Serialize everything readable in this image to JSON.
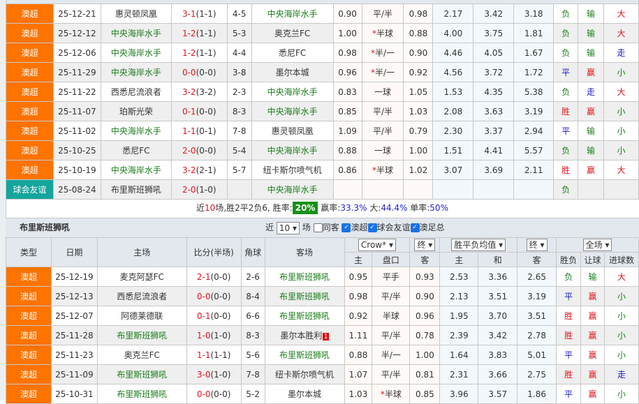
{
  "colors": {
    "league": "#ff7300",
    "friendly": "#14a59c",
    "win": "#e0141e",
    "lose": "#1b7d1b",
    "draw": "#1616c8"
  },
  "top_rows": [
    [
      "澳超",
      "25-12-21",
      "惠灵顿凤凰",
      "3-1",
      "(1-1)",
      "4-5",
      "中央海岸水手",
      "away",
      "0.90",
      "平/半",
      "0.98",
      "2.17",
      "3.42",
      "3.18",
      "负",
      "输",
      "大"
    ],
    [
      "澳超",
      "25-12-12",
      "中央海岸水手",
      "1-2",
      "(1-1)",
      "5-3",
      "奥克兰FC",
      "home",
      "1.00",
      "*半球",
      "0.88",
      "4.00",
      "3.75",
      "1.81",
      "负",
      "输",
      "大"
    ],
    [
      "澳超",
      "25-12-06",
      "中央海岸水手",
      "1-2",
      "(1-1)",
      "4-4",
      "悉尼FC",
      "home",
      "0.98",
      "*半/一",
      "0.90",
      "4.46",
      "4.05",
      "1.67",
      "负",
      "输",
      "走"
    ],
    [
      "澳超",
      "25-11-29",
      "中央海岸水手",
      "0-0",
      "(0-0)",
      "3-8",
      "墨尔本城",
      "home",
      "0.96",
      "*半/一",
      "0.92",
      "4.56",
      "3.72",
      "1.72",
      "平",
      "赢",
      "小"
    ],
    [
      "澳超",
      "25-11-22",
      "西悉尼流浪者",
      "3-2",
      "(3-2)",
      "2-3",
      "中央海岸水手",
      "away",
      "0.83",
      "一球",
      "1.05",
      "1.53",
      "4.35",
      "5.38",
      "负",
      "走",
      "大"
    ],
    [
      "澳超",
      "25-11-07",
      "珀斯光荣",
      "0-1",
      "(0-0)",
      "8-3",
      "中央海岸水手",
      "away",
      "0.85",
      "平/半",
      "1.03",
      "2.08",
      "3.63",
      "3.19",
      "胜",
      "赢",
      "小"
    ],
    [
      "澳超",
      "25-11-02",
      "中央海岸水手",
      "1-1",
      "(0-1)",
      "7-8",
      "惠灵顿凤凰",
      "home",
      "1.09",
      "平/半",
      "0.79",
      "2.30",
      "3.37",
      "2.94",
      "平",
      "输",
      "小"
    ],
    [
      "澳超",
      "25-10-25",
      "悉尼FC",
      "2-0",
      "(0-0)",
      "5-4",
      "中央海岸水手",
      "away",
      "0.88",
      "一球",
      "1.00",
      "1.51",
      "4.41",
      "5.57",
      "负",
      "输",
      "小"
    ],
    [
      "澳超",
      "25-10-19",
      "中央海岸水手",
      "3-2",
      "(2-1)",
      "5-7",
      "纽卡斯尔喷气机",
      "home",
      "0.86",
      "*半球",
      "1.02",
      "3.07",
      "3.69",
      "2.11",
      "胜",
      "赢",
      "大"
    ],
    [
      "球会友谊",
      "25-08-24",
      "布里斯班狮吼",
      "2-0",
      "(1-0)",
      "",
      "中央海岸水手",
      "away",
      "",
      "",
      "",
      "",
      "",
      "",
      "负",
      "",
      ""
    ]
  ],
  "summary": {
    "p1": "近",
    "n": "10",
    "p2": "场,胜2平2负6, 胜率:",
    "win_rate": "20%",
    "p3": " 赢率:",
    "cover_rate": "33.3%",
    "p4": " 大:",
    "over_rate": "44.4%",
    "p5": " 单率:",
    "odd_rate": "50%"
  },
  "section": {
    "team": "布里斯班狮吼",
    "near": "近",
    "count": "10",
    "games": "场",
    "same_away": "同客",
    "filters": [
      "澳超",
      "球会友谊",
      "澳足总"
    ]
  },
  "headers": {
    "type": "类型",
    "date": "日期",
    "home": "主场",
    "score": "比分(半场)",
    "corner": "角球",
    "away": "客场",
    "company": "Crow*",
    "final1": "终",
    "avg": "胜平负均值",
    "final2": "终",
    "scope": "全场",
    "cols": [
      "主",
      "盘口",
      "客",
      "主",
      "和",
      "客",
      "胜负",
      "让球",
      "进球数"
    ]
  },
  "bottom_rows": [
    [
      "澳超",
      "25-12-19",
      "麦克阿瑟FC",
      "2-1",
      "(0-0)",
      "2-6",
      "布里斯班狮吼",
      "away",
      "0.95",
      "平手",
      "0.93",
      "2.53",
      "3.36",
      "2.65",
      "负",
      "输",
      "大"
    ],
    [
      "澳超",
      "25-12-13",
      "西悉尼流浪者",
      "0-0",
      "(0-0)",
      "8-4",
      "布里斯班狮吼",
      "away",
      "0.98",
      "平/半",
      "0.90",
      "2.13",
      "3.51",
      "3.19",
      "平",
      "赢",
      "小"
    ],
    [
      "澳超",
      "25-12-07",
      "阿德莱德联",
      "0-1",
      "(0-0)",
      "6-6",
      "布里斯班狮吼",
      "away",
      "0.92",
      "半球",
      "0.96",
      "1.95",
      "3.70",
      "3.51",
      "胜",
      "赢",
      "小"
    ],
    [
      "澳超",
      "25-11-28",
      "布里斯班狮吼",
      "1-0",
      "(1-0)",
      "8-3",
      "墨尔本胜利",
      "home",
      "1.11",
      "平/半",
      "0.78",
      "2.39",
      "3.42",
      "2.78",
      "胜",
      "赢",
      "小"
    ],
    [
      "澳超",
      "25-11-23",
      "奥克兰FC",
      "1-1",
      "(1-1)",
      "5-6",
      "布里斯班狮吼",
      "away",
      "0.88",
      "半/一",
      "1.00",
      "1.64",
      "3.83",
      "5.01",
      "平",
      "赢",
      "小"
    ],
    [
      "澳超",
      "25-11-09",
      "布里斯班狮吼",
      "3-0",
      "(1-0)",
      "7-8",
      "纽卡斯尔喷气机",
      "home",
      "1.07",
      "平/半",
      "0.81",
      "2.31",
      "3.66",
      "2.75",
      "胜",
      "赢",
      "走"
    ],
    [
      "澳超",
      "25-10-31",
      "布里斯班狮吼",
      "0-0",
      "(0-0)",
      "5-2",
      "墨尔本城",
      "home",
      "1.03",
      "*半球",
      "0.85",
      "3.96",
      "3.57",
      "1.86",
      "平",
      "赢",
      "小"
    ]
  ],
  "red_card": {
    "row": 3,
    "value": "1"
  }
}
